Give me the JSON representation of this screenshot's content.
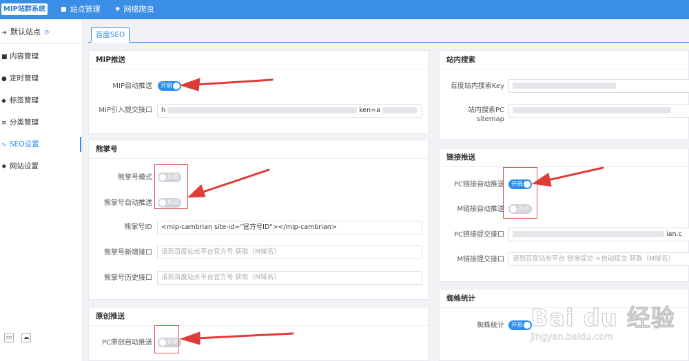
{
  "topbar": {
    "logo": "MIP站群系统",
    "nav": [
      {
        "label": "站点管理",
        "icon": "square-icon"
      },
      {
        "label": "网络爬虫",
        "icon": "gear-icon"
      }
    ]
  },
  "sidebar": {
    "site": "默认站点",
    "items": [
      {
        "label": "内容管理",
        "icon": "square-icon"
      },
      {
        "label": "定时管理",
        "icon": "clock-icon"
      },
      {
        "label": "标签管理",
        "icon": "tag-icon"
      },
      {
        "label": "分类管理",
        "icon": "list-icon"
      },
      {
        "label": "SEO设置",
        "icon": "pulse-icon",
        "active": true
      },
      {
        "label": "网站设置",
        "icon": "gear-icon"
      }
    ]
  },
  "tabs": [
    {
      "label": "百度SEO",
      "active": true
    }
  ],
  "mip": {
    "title": "MIP推送",
    "auto_push_label": "MIP自动推送",
    "auto_push_state": "开启",
    "api_label": "MIP引入提交接口",
    "api_value_start": "h",
    "api_value_mid": "ken=a"
  },
  "xzh": {
    "title": "熊掌号",
    "mode_label": "熊掌号模式",
    "mode_state": "关闭",
    "auto_push_label": "熊掌号自动推送",
    "auto_push_state": "关闭",
    "id_label": "熊掌号ID",
    "id_value": "<mip-cambrian site-id=\"官方号ID\"></mip-cambrian>",
    "new_api_label": "熊掌号新增接口",
    "new_api_placeholder": "请到百度站长平台官方号 获取（M域名）",
    "history_api_label": "熊掌号历史接口",
    "history_api_placeholder": "请到百度站长平台官方号 获取（M域名）"
  },
  "original": {
    "title": "原创推送",
    "pc_push_label": "PC原创自动推送",
    "pc_push_state": "关闭"
  },
  "site_search": {
    "title": "站内搜索",
    "key_label": "百度站内搜索Key",
    "sitemap_label_1": "站内搜索PC",
    "sitemap_label_2": "sitemap"
  },
  "link_push": {
    "title": "链接推送",
    "pc_auto_label": "PC链接自动推送",
    "pc_auto_state": "开启",
    "m_auto_label": "M链接自动推送",
    "m_auto_state": "关闭",
    "pc_api_label": "PC链接提交接口",
    "pc_api_value_end": "ian.c",
    "m_api_label": "M链接提交接口",
    "m_api_placeholder": "请到百度站长平台 链接提交->自动提交 获取（M域名）"
  },
  "spider": {
    "title": "蜘蛛统计",
    "stats_label": "蜘蛛统计",
    "stats_state": "开启"
  },
  "watermark": {
    "brand": "Bai du 经验",
    "url": "jingyan.baidu.com"
  },
  "colors": {
    "topbar": "#3a8ee6",
    "accent": "#2d8cf0",
    "annotation": "#e03b36"
  }
}
